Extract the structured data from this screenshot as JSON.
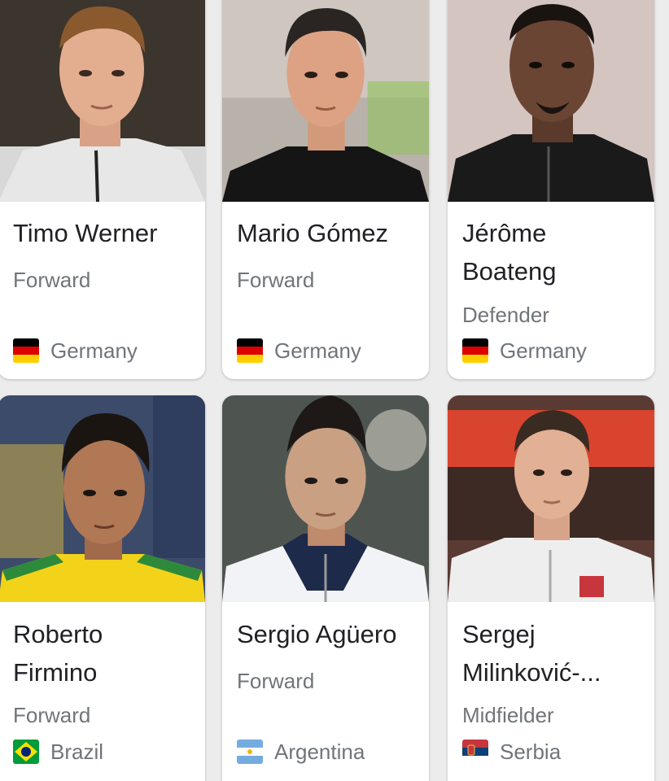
{
  "players": [
    {
      "name": "Timo Werner",
      "position": "Forward",
      "country": "Germany",
      "flag_icon": "germany-flag-icon"
    },
    {
      "name": "Mario Gómez",
      "position": "Forward",
      "country": "Germany",
      "flag_icon": "germany-flag-icon"
    },
    {
      "name": "Jérôme Boateng",
      "position": "Defender",
      "country": "Germany",
      "flag_icon": "germany-flag-icon"
    },
    {
      "name": "Roberto Firmino",
      "position": "Forward",
      "country": "Brazil",
      "flag_icon": "brazil-flag-icon"
    },
    {
      "name": "Sergio Agüero",
      "position": "Forward",
      "country": "Argentina",
      "flag_icon": "argentina-flag-icon"
    },
    {
      "name": "Sergej Milinković-...",
      "position": "Midfielder",
      "country": "Serbia",
      "flag_icon": "serbia-flag-icon"
    }
  ],
  "colors": {
    "page_background": "#ececec",
    "card_background": "#ffffff",
    "name_text": "#202124",
    "secondary_text": "#70757a"
  }
}
